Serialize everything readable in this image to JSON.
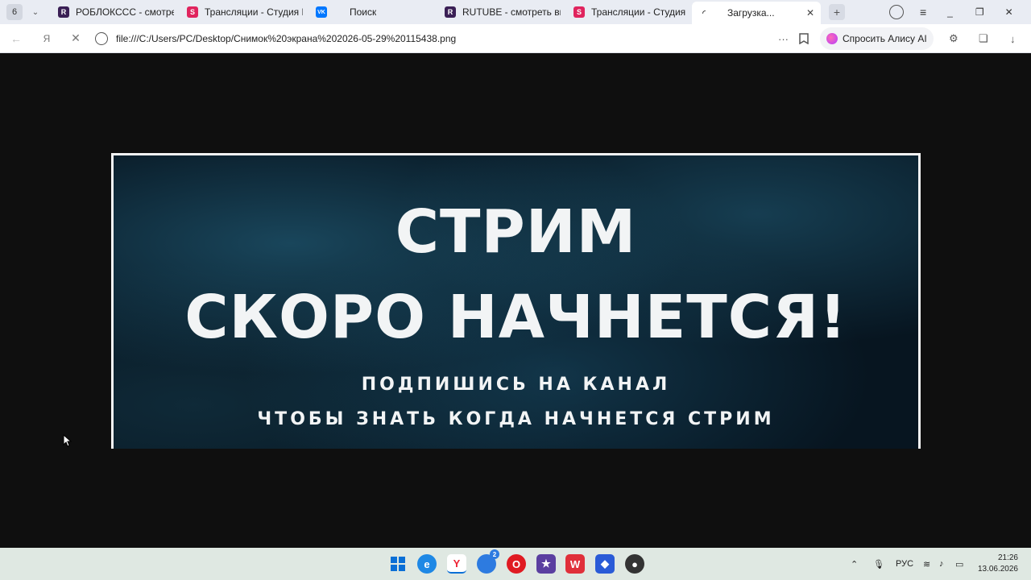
{
  "tabbar": {
    "count": "6",
    "tabs": [
      {
        "title": "РОБЛОКССС - смотреть",
        "fav": "R",
        "color": "#3a1f55"
      },
      {
        "title": "Трансляции - Студия RU",
        "fav": "S",
        "color": "#e0245e"
      },
      {
        "title": "",
        "fav": "VK",
        "color": "#0077ff"
      },
      {
        "title": "Поиск",
        "fav": "",
        "color": ""
      },
      {
        "title": "RUTUBE - смотреть вида",
        "fav": "R",
        "color": "#3a1f55"
      },
      {
        "title": "Трансляции - Студия RU",
        "fav": "S",
        "color": "#e0245e"
      },
      {
        "title": "Загрузка...",
        "fav": "",
        "color": ""
      }
    ],
    "new_tab": "+",
    "close_tab": "✕"
  },
  "address": {
    "url": "file:///C:/Users/PC/Desktop/Снимок%20экрана%202026-05-29%20115438.png",
    "alice": "Спросить Алису AI",
    "more": "···"
  },
  "banner": {
    "line1": "СТРИМ",
    "line2": "СКОРО НАЧНЕТСЯ!",
    "line3": "ПОДПИШИСЬ НА КАНАЛ",
    "line4": "ЧТОБЫ ЗНАТЬ КОГДА НАЧНЕТСЯ СТРИМ"
  },
  "taskbar": {
    "lang": "РУС",
    "time": "21:26",
    "date": "13.06.2026",
    "badge": "2"
  }
}
